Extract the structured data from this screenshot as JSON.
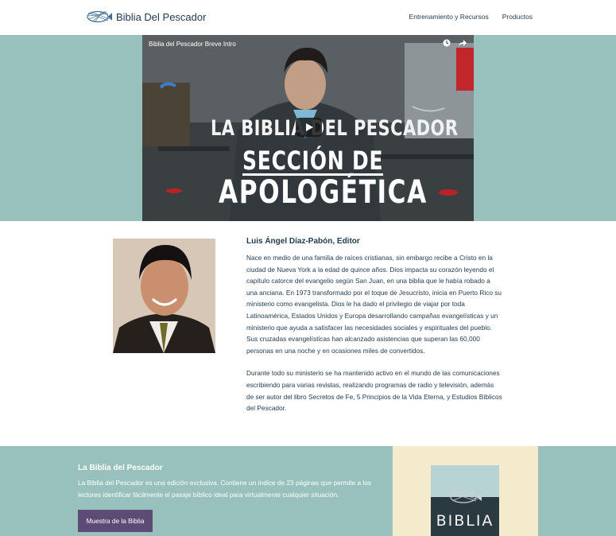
{
  "header": {
    "brand": "Biblia Del Pescador",
    "nav": [
      "Entrenamiento y Recursos",
      "Productos"
    ]
  },
  "video": {
    "title": "Biblia del Pescador Breve Intro",
    "overlay_line1": "LA BIBLIA DEL PESCADOR",
    "overlay_line2": "SECCIÓN DE",
    "overlay_line3": "APOLOGÉTICA"
  },
  "bio": {
    "name": "Luis Ángel Díaz-Pabón, Editor",
    "paragraph1": "Nace en medio de una familia de raíces cristianas, sin embargo recibe a Cristo en la ciudad de Nueva York a la edad de quince años. Dios impacta su corazón leyendo el capítulo catorce del evangelio según San Juan, en una biblia que le había robado a una anciana. En 1973 transformado por el toque de Jesucristo, inicia en Puerto Rico su ministerio como evangelista. Dios le ha dado el privilegio de viajar por toda Latinoamérica, Estados Unidos y Europa desarrollando campañas evangelísticas y un ministerio que ayuda a satisfacer las necesidades sociales y espirituales del pueblo. Sus cruzadas evangelísticas han alcanzado asistencias que superan las 60,000 personas en una noche y en ocasiones miles de convertidos.",
    "paragraph2": "Durante todo su ministerio se ha mantenido activo en el mundo de las comunicaciones escribiendo para varias revistas, realizando programas de radio y televisión, además de ser autor del libro Secretos de Fe, 5 Principios de la Vida Eterna, y Estudios Bíblicos del Pescador."
  },
  "promo": {
    "title": "La Biblia del Pescador",
    "description": "La Biblia del Pescador es una edición exclusiva. Contiene un índice de 23 páginas que permite a los lectores identificar fácilmente el pasaje bíblico ideal para virtualmente cualquier situación.",
    "button": "Muestra de la Biblia",
    "book_title": "BIBLIA"
  },
  "colors": {
    "teal_band": "#98c0bc",
    "text_navy": "#1d3a4f",
    "button_purple": "#5d4a75",
    "cream_panel": "#f3ebcb"
  }
}
